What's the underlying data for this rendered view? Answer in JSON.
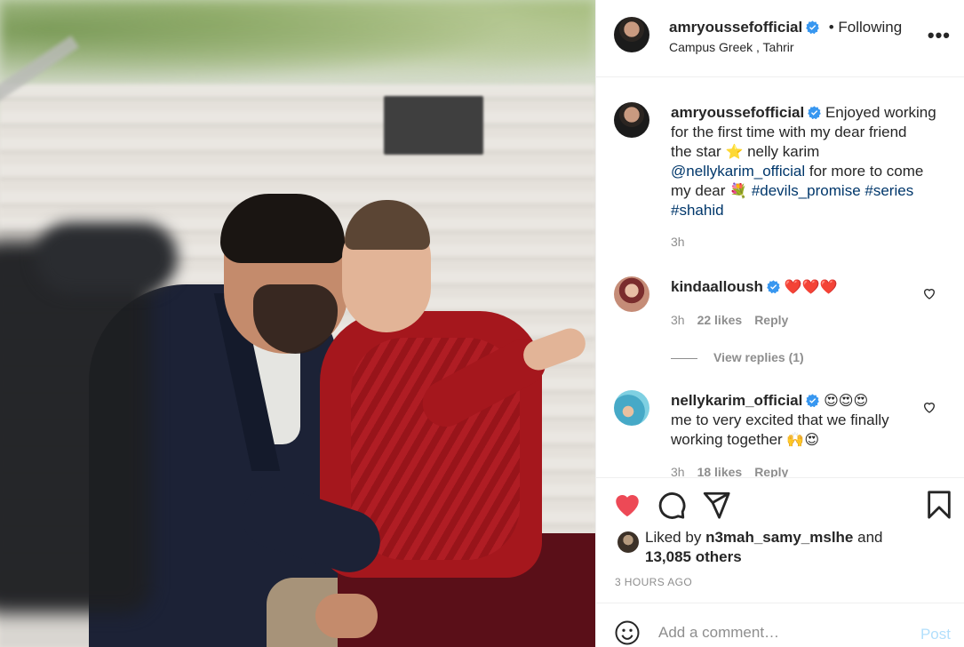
{
  "post": {
    "author": "amryoussefofficial",
    "following": "• Following",
    "location": "Campus Greek , Tahrir",
    "more": "•••",
    "caption": {
      "author": "amryoussefofficial",
      "line1": "Enjoyed working",
      "line2": "for the first time with my dear friend",
      "line3_prefix": "the star",
      "star_emoji": "⭐",
      "line3_suffix": "nelly karim",
      "mention": "@nellykarim_official",
      "line4_suffix": "for more to come",
      "line5_prefix": "my dear",
      "bouquet_emoji": "💐",
      "tag1": "#devils_promise",
      "tag2": "#series",
      "tag3": "#shahid",
      "time": "3h"
    }
  },
  "comments": [
    {
      "user": "kindaalloush",
      "text": "❤️❤️❤️",
      "time": "3h",
      "likes": "22 likes",
      "reply": "Reply",
      "view_replies": "View replies (1)"
    },
    {
      "user": "nellykarim_official",
      "emojis": "😍😍😍",
      "text_line1": "me to very excited that we finally",
      "text_line2": "working together",
      "emojis2": "🙌😍",
      "time": "3h",
      "likes": "18 likes",
      "reply": "Reply"
    }
  ],
  "likes": {
    "prefix": "Liked by",
    "user": "n3mah_samy_mslhe",
    "and": "and",
    "others": "13,085 others"
  },
  "posted_ago": "3 HOURS AGO",
  "comment_box": {
    "placeholder": "Add a comment…",
    "post_label": "Post"
  },
  "colors": {
    "like_red": "#ed4956",
    "link_blue": "#00376b",
    "verified_blue": "#3897f0",
    "post_disabled": "#b2dffc"
  },
  "icons": [
    "heart-icon",
    "comment-icon",
    "share-icon",
    "bookmark-icon",
    "emoji-icon",
    "verified-icon",
    "more-icon"
  ]
}
